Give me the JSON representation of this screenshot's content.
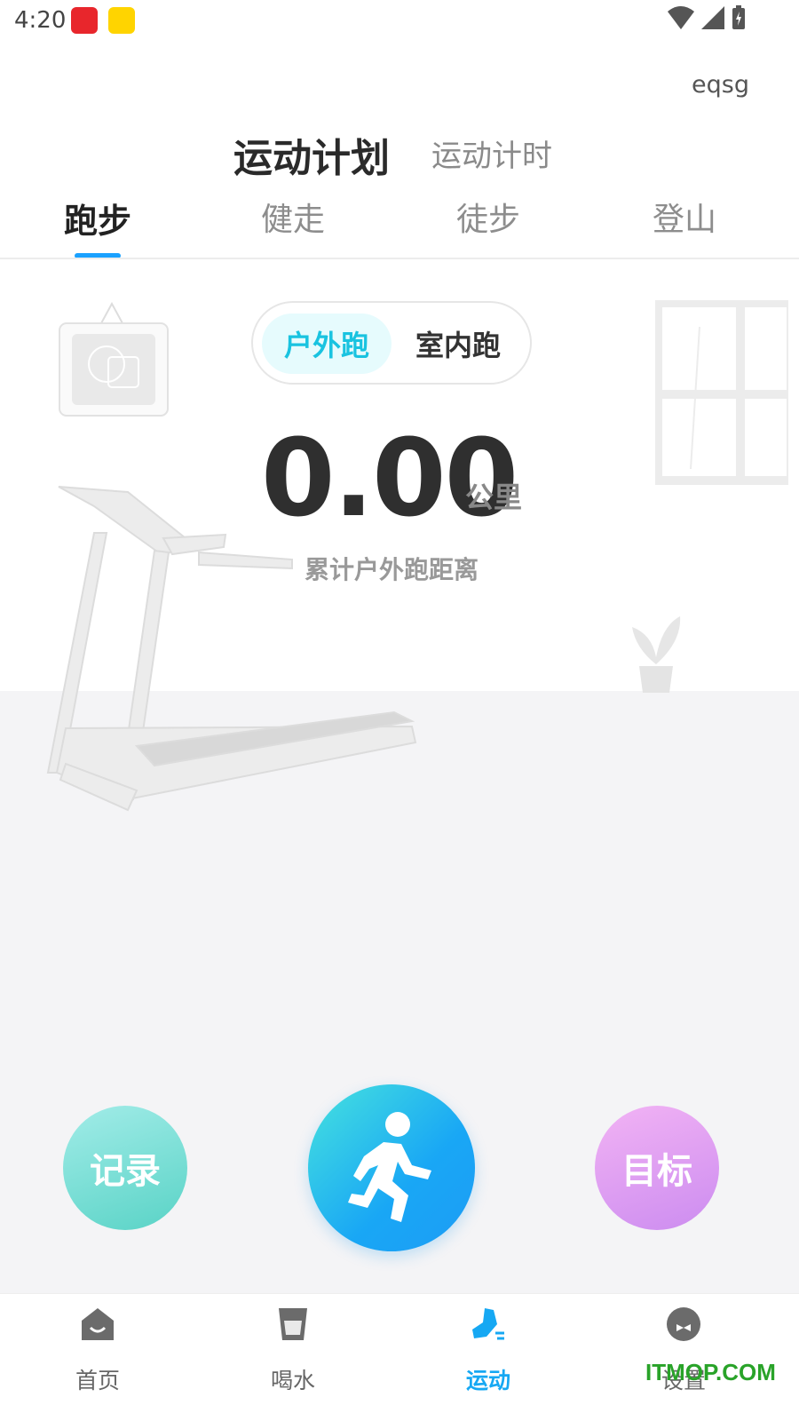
{
  "status_bar": {
    "time": "4:20"
  },
  "header": {
    "user_name": "eqsg",
    "tabs": [
      {
        "label": "运动计划",
        "active": true
      },
      {
        "label": "运动计时",
        "active": false
      }
    ]
  },
  "sport_tabs": [
    {
      "label": "跑步",
      "active": true
    },
    {
      "label": "健走",
      "active": false
    },
    {
      "label": "徒步",
      "active": false
    },
    {
      "label": "登山",
      "active": false
    }
  ],
  "run_toggle": {
    "outdoor": "户外跑",
    "indoor": "室内跑",
    "selected": "outdoor"
  },
  "stats": {
    "distance": "0.00",
    "unit": "公里",
    "label": "累计户外跑距离"
  },
  "actions": {
    "record": "记录",
    "goal": "目标",
    "start_icon": "running-person-icon"
  },
  "bottom_nav": [
    {
      "label": "首页",
      "icon": "home-icon",
      "active": false
    },
    {
      "label": "喝水",
      "icon": "cup-icon",
      "active": false
    },
    {
      "label": "运动",
      "icon": "shoe-icon",
      "active": true
    },
    {
      "label": "设置",
      "icon": "settings-face-icon",
      "active": false
    }
  ],
  "watermark": "ITMOP.COM",
  "colors": {
    "accent": "#16a8f3",
    "toggle_active": "#19c3e0",
    "record": "#59d3c6",
    "goal": "#cc8cf0"
  }
}
